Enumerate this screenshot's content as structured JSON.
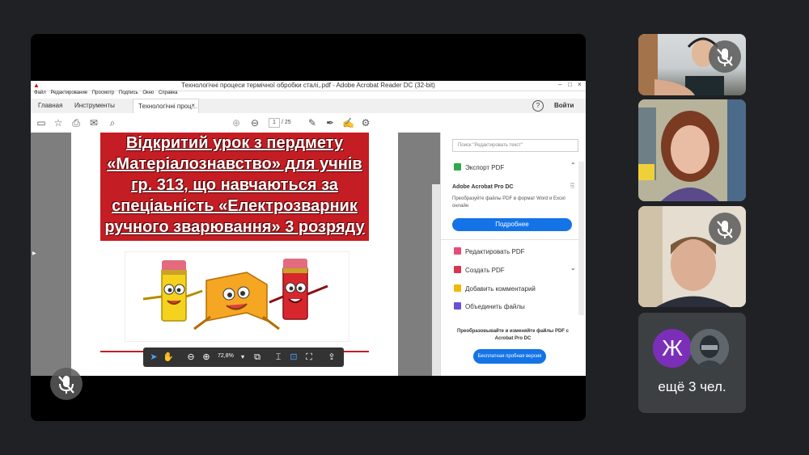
{
  "acrobat": {
    "window_title": "Технологічні процеси термічної обробки сталі,.pdf - Adobe Acrobat Reader DC (32-bit)",
    "menu": [
      "Файл",
      "Редактирование",
      "Просмотр",
      "Подпись",
      "Окно",
      "Справка"
    ],
    "tabs": {
      "home": "Главная",
      "tools": "Инструменты",
      "document": "Технологічні проц..."
    },
    "sign_in": "Войти",
    "page_current": "1",
    "page_total": "/ 25",
    "zoom": "72,8%",
    "document": {
      "title_lines": [
        "Відкритий урок з пердмету",
        "«Матеріалознавство» для учнів",
        "гр. 313, що навчаються за",
        "спеціаьність «Електрозварник",
        "ручного зварювання» 3 розряду"
      ]
    },
    "right_pane": {
      "search_placeholder": "Поиск \"Редактировать текст\"",
      "export_pdf": "Экспорт PDF",
      "product_name": "Adobe Acrobat Pro DC",
      "product_desc": "Преобразуйте файлы PDF в формат Word и Excel онлайн",
      "more_button": "Подробнее",
      "tools": [
        "Редактировать PDF",
        "Создать PDF",
        "Добавить комментарий",
        "Объединить файлы"
      ],
      "promo": "Преобразовывайте и изменяйте файлы PDF с Acrobat Pro DC",
      "trial_button": "Бесплатная пробная версия"
    }
  },
  "participants": {
    "avatar_letter": "Ж",
    "more_label": "ещё 3 чел."
  },
  "colors": {
    "meet_bg": "#202124",
    "title_red": "#c41d23",
    "acrobat_blue": "#1473e6"
  }
}
